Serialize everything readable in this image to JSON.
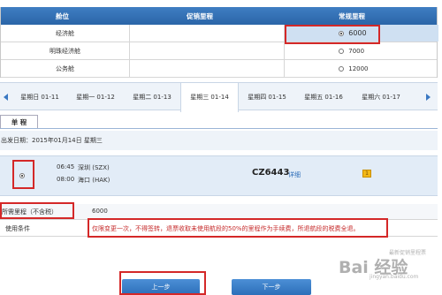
{
  "fare_table": {
    "headers": [
      "舱位",
      "促销里程",
      "常规里程"
    ],
    "rows": [
      {
        "cabin": "经济舱",
        "promo": "",
        "regular": "6000",
        "selected": true
      },
      {
        "cabin": "明珠经济舱",
        "promo": "",
        "regular": "7000",
        "selected": false
      },
      {
        "cabin": "公务舱",
        "promo": "",
        "regular": "12000",
        "selected": false
      }
    ]
  },
  "date_strip": {
    "days": [
      {
        "label": "星期日 01-11",
        "active": false
      },
      {
        "label": "星期一 01-12",
        "active": false
      },
      {
        "label": "星期二 01-13",
        "active": false
      },
      {
        "label": "星期三 01-14",
        "active": true
      },
      {
        "label": "星期四 01-15",
        "active": false
      },
      {
        "label": "星期五 01-16",
        "active": false
      },
      {
        "label": "星期六 01-17",
        "active": false
      }
    ]
  },
  "route_tab": "单 程",
  "departure_info": "出发日期：2015年01月14日     星期三",
  "flight": {
    "dep_time": "06:45",
    "dep_city": "深圳 (SZX)",
    "arr_time": "08:00",
    "arr_city": "海口 (HAK)",
    "flight_no": "CZ6443",
    "detail_link": "详细",
    "badge": "1"
  },
  "mileage": {
    "label": "所需里程（不含税）",
    "value": "6000"
  },
  "terms": {
    "label": "使用条件",
    "text": "仅限变更一次，不得签转，退票收取未使用航段的50%的里程作为手续费，所退航段的税费全退。"
  },
  "buttons": {
    "prev": "上一步",
    "next": "下一步"
  },
  "watermark": {
    "brand": "Bai 经验",
    "sub": "最新促销里程票",
    "site": "jingyan.baidu.com"
  }
}
